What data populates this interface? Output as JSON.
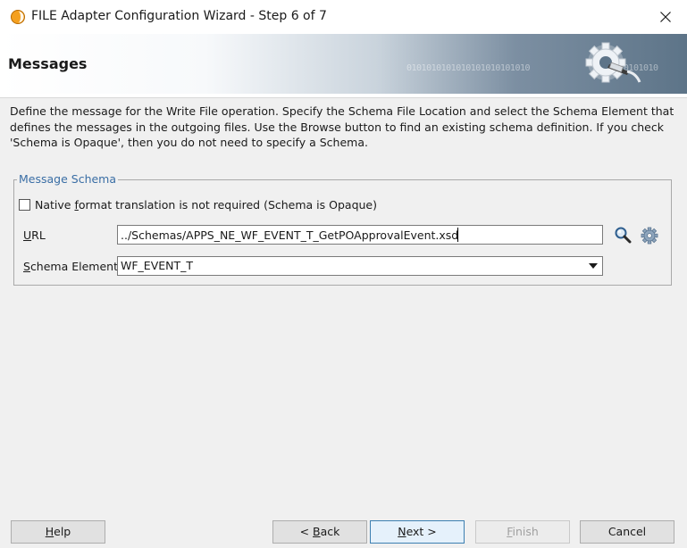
{
  "window": {
    "title": "FILE Adapter Configuration Wizard - Step 6 of 7",
    "icon": "oracle-adapter-icon"
  },
  "banner": {
    "title": "Messages",
    "binary_text": "0101010101010101010101010                 010101010"
  },
  "description": {
    "line1": "Define the message for the Write File operation.  Specify the Schema File Location and select the Schema Element that",
    "line2": "defines the messages in the outgoing files. Use the Browse button to find an existing schema definition. If you check",
    "line3": "'Schema is Opaque', then you do not need to specify a Schema."
  },
  "message_schema": {
    "legend": "Message Schema",
    "opaque_checkbox": {
      "checked": false,
      "label_pre": "Native ",
      "label_mnemonic": "f",
      "label_post": "ormat translation is not required (Schema is Opaque)"
    },
    "url": {
      "label_mnemonic": "U",
      "label_rest": "RL",
      "value": "../Schemas/APPS_NE_WF_EVENT_T_GetPOApprovalEvent.xsd",
      "browse_icon": "magnifier-icon",
      "settings_icon": "gear-icon"
    },
    "schema_element": {
      "label_mnemonic": "S",
      "label_rest": "chema Element",
      "selected": "WF_EVENT_T"
    }
  },
  "buttons": {
    "help": {
      "mnemonic": "H",
      "rest": "elp"
    },
    "back": {
      "pre": "< ",
      "mnemonic": "B",
      "rest": "ack"
    },
    "next": {
      "mnemonic": "N",
      "rest": "ext >"
    },
    "finish": {
      "mnemonic": "F",
      "rest": "inish",
      "enabled": false
    },
    "cancel": {
      "label": "Cancel"
    }
  }
}
